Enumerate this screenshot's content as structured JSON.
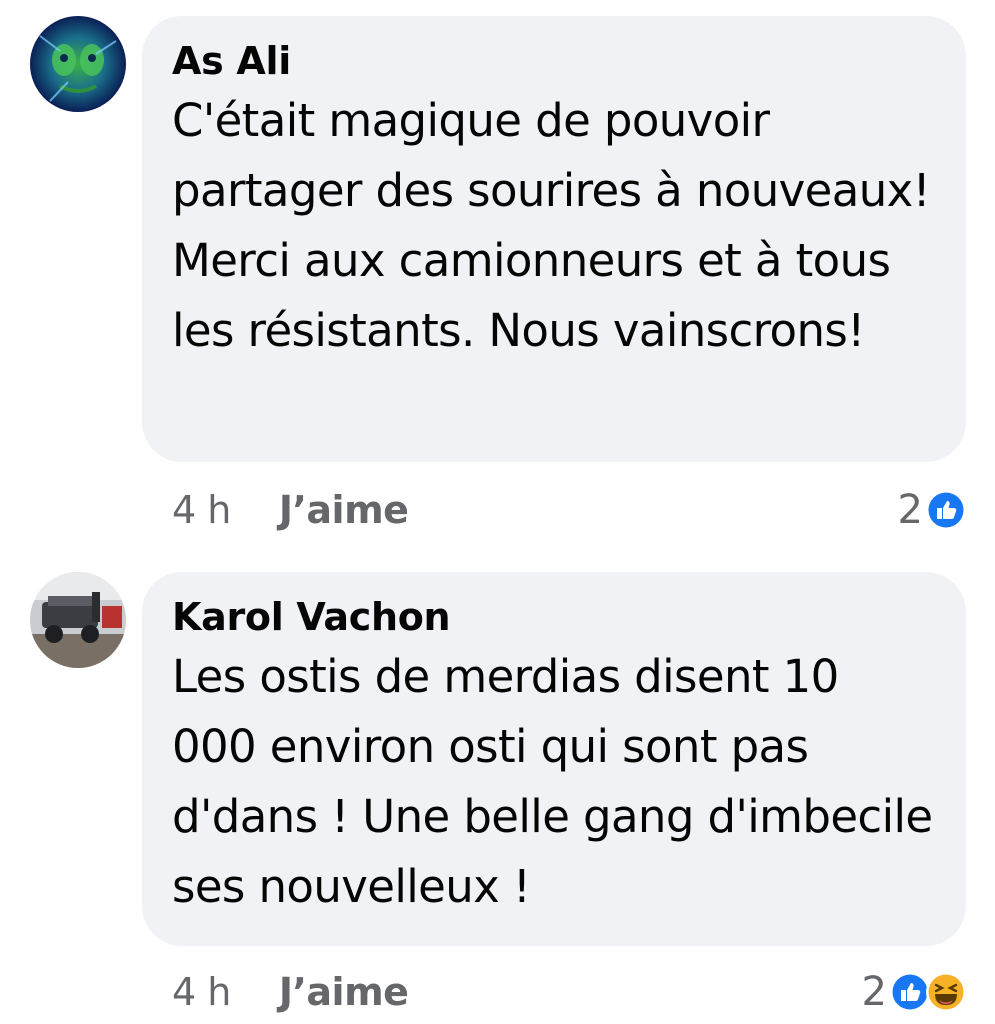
{
  "comments": [
    {
      "author": "As Ali",
      "text": "C'était magique de pouvoir partager des sourires à nouveaux! Merci aux camionneurs et à tous les résistants. Nous vainscrons!",
      "time": "4 h",
      "like_label": "J’aime",
      "reaction_count": "2",
      "reactions": [
        "like-icon"
      ]
    },
    {
      "author": "Karol Vachon",
      "text": "Les ostis de merdias disent 10 000 environ osti qui sont pas d'dans ! Une belle gang d'imbecile ses nouvelleux !",
      "time": "4 h",
      "like_label": "J’aime",
      "reaction_count": "2",
      "reactions": [
        "like-icon",
        "haha-icon"
      ]
    }
  ],
  "colors": {
    "bubble": "#f0f2f5",
    "meta_text": "#65676b",
    "like_blue": "#1877f2",
    "haha_yellow": "#f7b125"
  }
}
